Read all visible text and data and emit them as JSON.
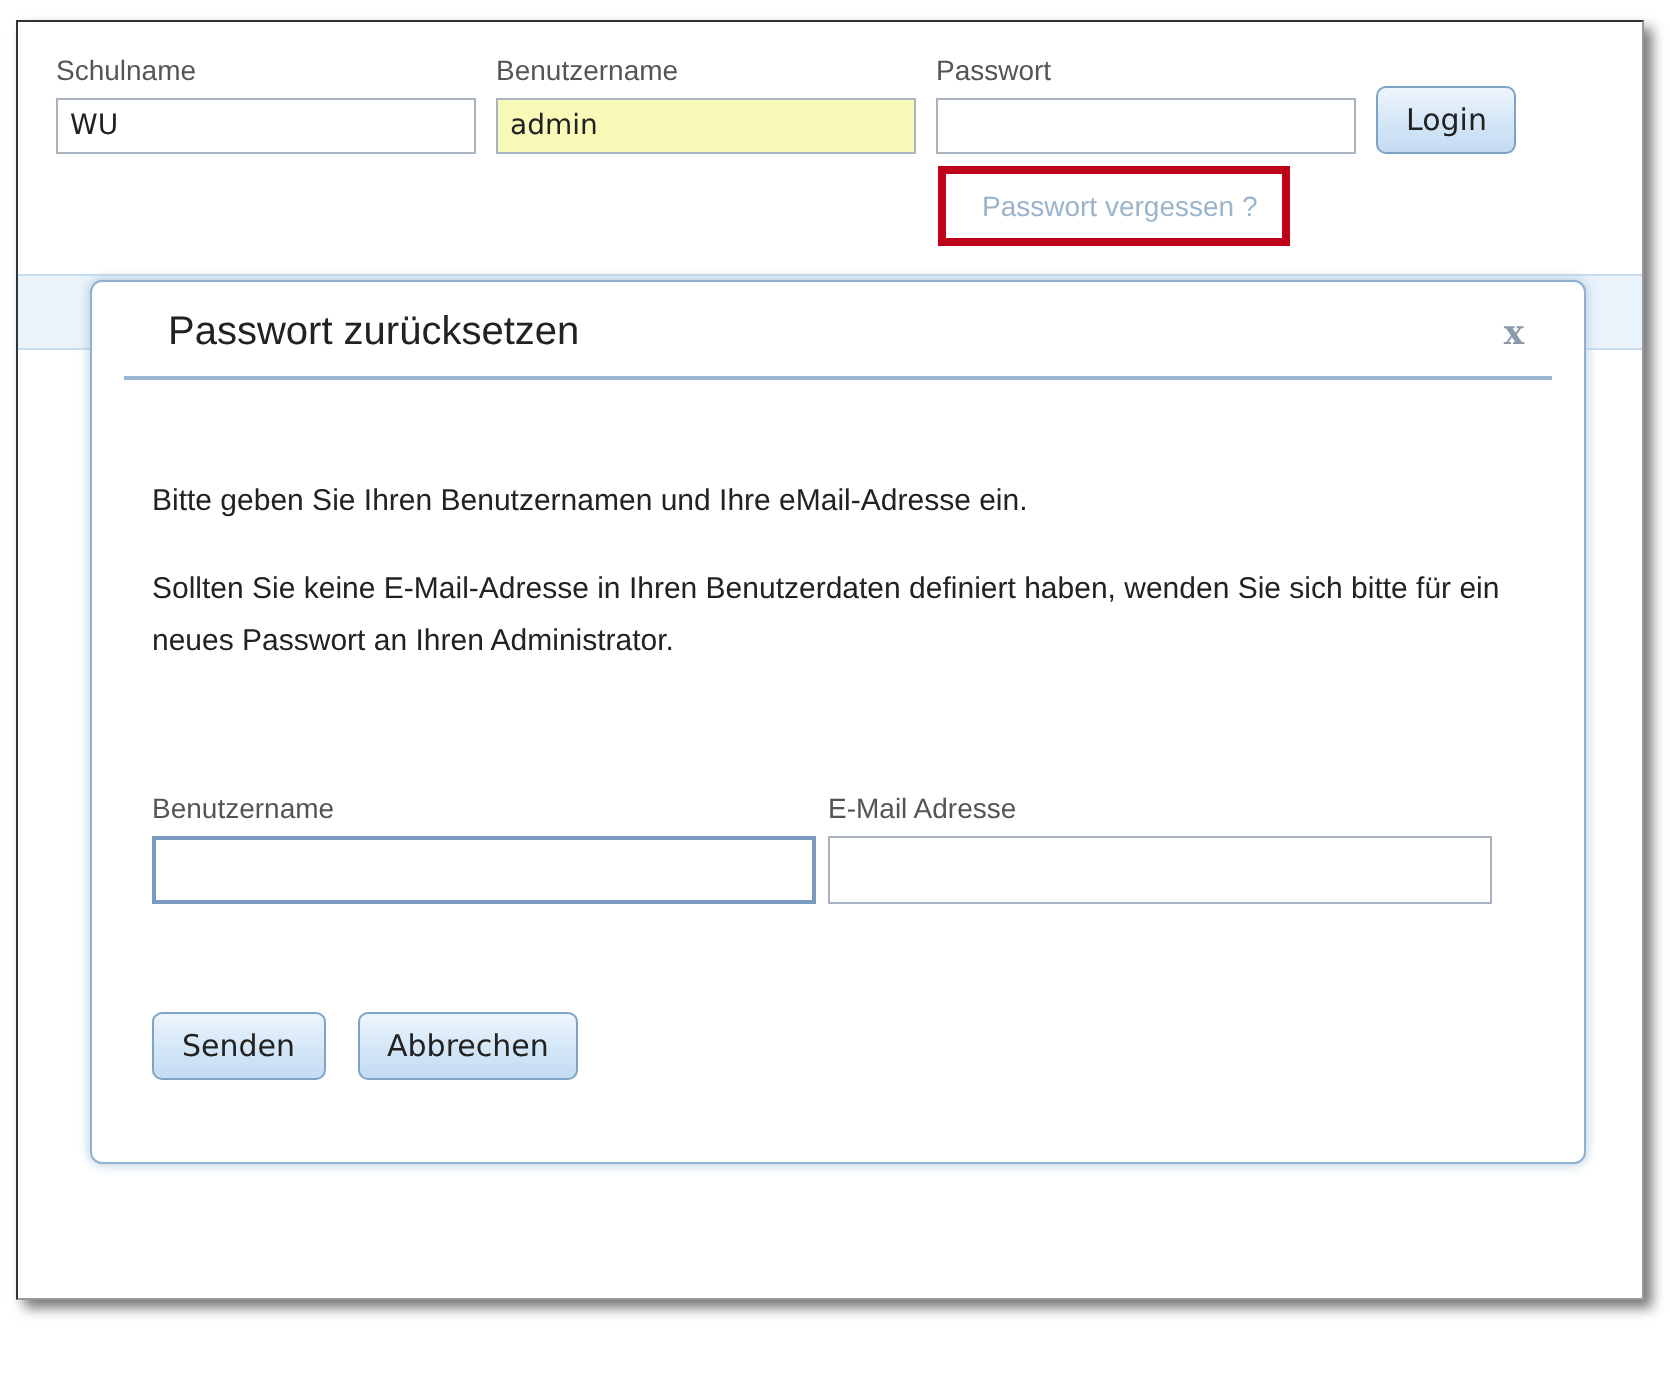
{
  "login": {
    "fields": [
      {
        "label": "Schulname",
        "value": "WU",
        "autofilled": false
      },
      {
        "label": "Benutzername",
        "value": "admin",
        "autofilled": true
      },
      {
        "label": "Passwort",
        "autofilled": false
      }
    ],
    "button": "Login",
    "forgot_link": {
      "label": "Passwort vergessen ?",
      "highlighted": true
    }
  },
  "dialog": {
    "title": "Passwort zurücksetzen",
    "close": "x",
    "paragraphs": [
      "Bitte geben Sie Ihren Benutzernamen und Ihre eMail-Adresse ein.",
      "Sollten Sie keine E-Mail-Adresse in Ihren Benutzerdaten definiert haben, wenden Sie sich bitte für ein neues Passwort an Ihren Administrator."
    ],
    "fields": [
      {
        "label": "Benutzername",
        "focused": true
      },
      {
        "label": "E-Mail Adresse",
        "focused": false
      }
    ],
    "buttons": [
      "Senden",
      "Abbrechen"
    ]
  }
}
